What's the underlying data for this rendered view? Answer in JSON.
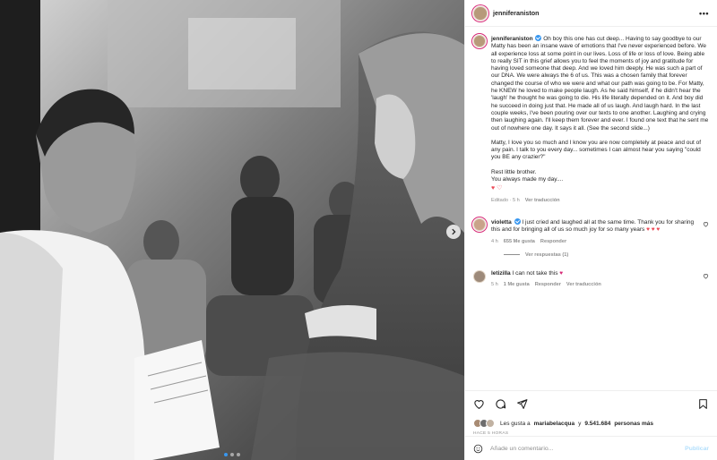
{
  "post": {
    "username": "jenniferaniston",
    "caption": {
      "p1": "Oh boy this one has cut deep... Having to say goodbye to our Matty has been an insane wave of emotions that I've never experienced before. We all experience loss at some point in our lives. Loss of life or loss of love. Being able to really SIT in this grief allows you to feel the moments of joy and gratitude for having loved someone that deep. And we loved him deeply. He was such a part of our DNA. We were always the 6 of us. This was a chosen family that forever changed the course of who we were and what our path was going to be. For Matty, he KNEW he loved to make people laugh. As he said himself, if he didn't hear the 'laugh' he thought he was going to die. His life literally depended on it. And boy did he succeed in doing just that. He made all of us laugh. And laugh hard. In the last couple weeks, I've been pouring over our texts to one another. Laughing and crying then laughing again. I'll keep them forever and ever. I found one text that he sent me out of nowhere one day. It says it all. (See the second slide...)",
      "p2": "Matty, I love you so much and I know you are now completely at peace and out of any pain. I talk to you every day... sometimes I can almost hear you saying \"could you BE any crazier?\"",
      "p3a": "Rest little brother.",
      "p3b": "You always made my day....",
      "hearts": "♥ ♡"
    },
    "meta": {
      "edited": "Editado · 5 h",
      "translate": "Ver traducción"
    }
  },
  "comments": [
    {
      "username": "violetta",
      "text": "I just cried and laughed all at the same time. Thank you for sharing this and for bringing all of us so much joy for so many years",
      "emoji": "♥ ♥ ♥",
      "time": "4 h",
      "likes": "655 Me gusta",
      "reply": "Responder",
      "view_replies": "Ver respuestas (1)"
    },
    {
      "username": "letizilla",
      "text": "I can not take this",
      "emoji": "♥",
      "time": "5 h",
      "likes": "1 Me gusta",
      "reply": "Responder",
      "translate": "Ver traducción"
    }
  ],
  "footer": {
    "likes_prefix": "Les gusta a",
    "liker": "mariabelacqua",
    "likes_mid": "y",
    "likes_count": "9.541.684",
    "likes_suffix": "personas más",
    "ago": "HACE 5 HORAS",
    "comment_placeholder": "Añade un comentario...",
    "publish": "Publicar"
  },
  "colors": {
    "verified": "#3897f0",
    "heart": "#ed4956",
    "accent": "#3897f0",
    "muted": "#8e8e8e"
  },
  "icons": [
    "more-icon",
    "next-arrow-icon",
    "heart-icon",
    "comment-icon",
    "share-icon",
    "bookmark-icon",
    "emoji-icon",
    "verified-icon"
  ]
}
